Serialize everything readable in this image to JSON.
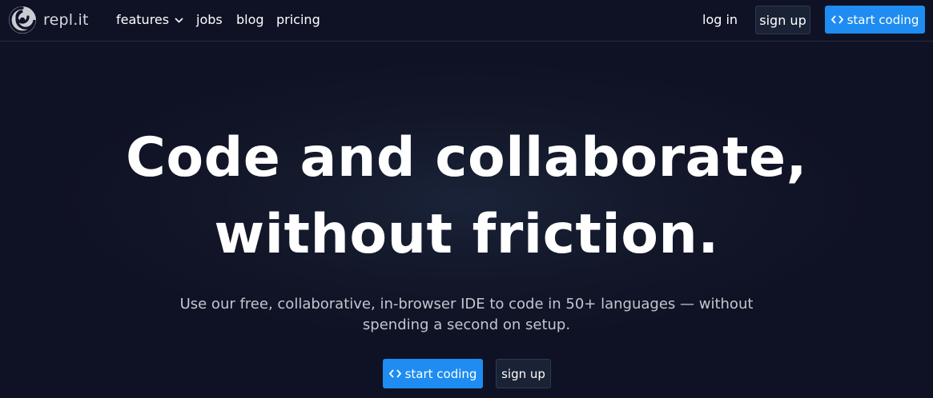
{
  "brand": {
    "name": "repl.it",
    "logo_icon": "replit-swirl-logo-icon"
  },
  "nav": {
    "features": "features",
    "jobs": "jobs",
    "blog": "blog",
    "pricing": "pricing",
    "login": "log in",
    "signup": "sign up",
    "start_coding": "start coding",
    "features_icon": "chevron-down-icon",
    "start_icon": "code-brackets-icon"
  },
  "hero": {
    "title_line1": "Code and collaborate,",
    "title_line2": "without friction.",
    "subtitle_line1": "Use our free, collaborative, in-browser IDE to code in 50+ languages — without",
    "subtitle_line2": "spending a second on setup.",
    "cta_start": "start coding",
    "cta_signup": "sign up"
  },
  "colors": {
    "background": "#0f1224",
    "accent": "#1e8cf0",
    "secondary_button": "#1a2236",
    "subtitle_text": "#c2c6d0"
  }
}
